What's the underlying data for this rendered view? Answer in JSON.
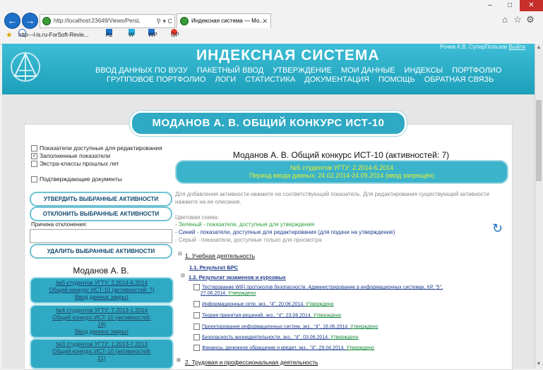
{
  "browser": {
    "address": "http://localhost:23649/Views/PersL",
    "tab_title": "Индексная система — Мо...",
    "favorites": [
      "http---l-is.ru-ForSoft-Revie...",
      "Az",
      "W",
      "WP",
      "GP"
    ]
  },
  "header": {
    "site_title": "ИНДЕКСНАЯ СИСТЕМА",
    "user": "Рочев К.В. СуперПользов",
    "logout": "Выйти",
    "menu_row1": [
      "ВВОД ДАННЫХ ПО ВУЗУ",
      "ПАКЕТНЫЙ ВВОД",
      "УТВЕРЖДЕНИЕ",
      "МОИ ДАННЫЕ",
      "ИНДЕКСЫ",
      "ПОРТФОЛИО"
    ],
    "menu_row2": [
      "ГРУППОВОЕ ПОРТФОЛИО",
      "ЛОГИ",
      "СТАТИСТИКА",
      "ДОКУМЕНТАЦИЯ",
      "ПОМОЩЬ",
      "ОБРАТНАЯ СВЯЗЬ"
    ]
  },
  "page_banner": "МОДАНОВ А. В. ОБЩИЙ КОНКУРС ИСТ-10",
  "filters": {
    "editable": "Показатели доступные для редактирования",
    "filled": "Заполненные показатели",
    "extra": "Экстра-классы прошлых лет",
    "docs": "Подтверждающие документы"
  },
  "buttons": {
    "approve": "УТВЕРДИТЬ ВЫБРАННЫЕ АКТИВНОСТИ",
    "reject": "ОТКЛОНИТЬ ВЫБРАННЫЕ АКТИВНОСТИ",
    "delete": "УДАЛИТЬ ВЫБРАННЫЕ АКТИВНОСТИ"
  },
  "reject_reason_label": "Причина отклонения:",
  "person_name": "Моданов А. В.",
  "periods": [
    {
      "l1": "№5 студентов УГТУ: 2.2014-6.2014",
      "l2": "Общий конкурс ИСТ-10 (активностей: 7)",
      "l3": "Ввод данных закрыт"
    },
    {
      "l1": "№4 студентов УГТУ: 7.2013-1.2014",
      "l2": "Общий конкурс ИСТ-10 (активностей:",
      "l3": "19)",
      "l4": "Ввод данных закрыт"
    },
    {
      "l1": "№3 студентов УГТУ: 1.2013-7.2013",
      "l2": "Общий конкурс ИСТ-10 (активностей:",
      "l3": "21)"
    }
  ],
  "right_title": "Моданов А. В. Общий конкурс ИСТ-10 (активностей: 7)",
  "info_banner": {
    "line1": "№5 студентов УГТУ: 2.2014-6.2014",
    "line2": "Период ввода данных: 24.02.2014-24.09.2014 (ввод запрещён)"
  },
  "hint": "Для добавления активности нажмите на соответствующий показатель. Для редактирования существующей активности нажмите на ее описание.",
  "legend": {
    "title": "Цветовая схема:",
    "green": "- Зеленый - показатели, доступные для утверждения",
    "blue": "- Синий - показатели, доступные для редактирования (для подачи на утверждение)",
    "gray": "- Серый - показатели, доступные только для просмотра"
  },
  "tree": {
    "s1": "1. Учебная деятельность",
    "s11": "1.1. Результат БРС",
    "s12": "1.2. Результат экзаменов и курсовых",
    "items": [
      {
        "text": "Тестирование WiFi протоколов безопасности. Администрирование в информационных системах, КР, \"5\",",
        "text2": "27.06.2014.",
        "status": "Утверждено"
      },
      {
        "text": "Информационные сети, экз., \"4\", 20.06.2014.",
        "status": "Утверждено"
      },
      {
        "text": "Теория принятия решений, экз., \"4\", 23.06.2014.",
        "status": "Утверждено"
      },
      {
        "text": "Проектирование информационных систем, экз., \"4\", 18.06.2014.",
        "status": "Утверждено"
      },
      {
        "text": "Безопасность жизнедеятельности, экз., \"4\", 03.06.2014.",
        "status": "Утверждено"
      },
      {
        "text": "Финансы, денежное обращение и кредит, экз., \"4\", 29.04.2014.",
        "status": "Утверждено"
      }
    ],
    "s2": "2. Трудовая и профессиональная деятельность"
  }
}
